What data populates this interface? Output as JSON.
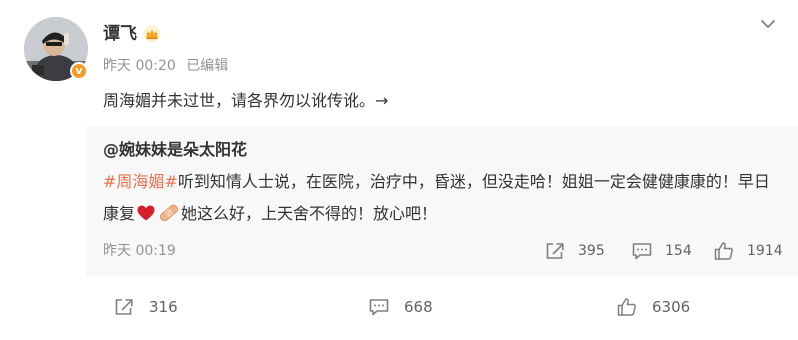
{
  "author": {
    "name": "谭飞",
    "badge_symbol": "v",
    "time": "昨天 00:20",
    "edited": "已编辑"
  },
  "post": {
    "text": "周海媚并未过世，请各界勿以讹传讹。→"
  },
  "repost": {
    "author": "@婉妹妹是朵太阳花",
    "hashtag": "#周海媚#",
    "text_part1": "听到知情人士说，在医院，治疗中，昏迷，但没走哈！姐姐一定会健健康康的！早日康复",
    "emojis": [
      "heart",
      "bandage"
    ],
    "text_part2": "她这么好，上天舍不得的！放心吧！",
    "time": "昨天 00:19",
    "reposts": "395",
    "comments": "154",
    "likes": "1914"
  },
  "footer": {
    "reposts": "316",
    "comments": "668",
    "likes": "6306"
  },
  "colors": {
    "hashtag": "#eb7350",
    "meta": "#939393",
    "badge": "#f59a23",
    "repost_bg": "#f8f8f8"
  },
  "icons": [
    "avatar",
    "verified-icon",
    "crown-icon",
    "chevron-down-icon",
    "repost-icon",
    "comment-icon",
    "like-icon",
    "heart-emoji",
    "bandage-emoji"
  ]
}
